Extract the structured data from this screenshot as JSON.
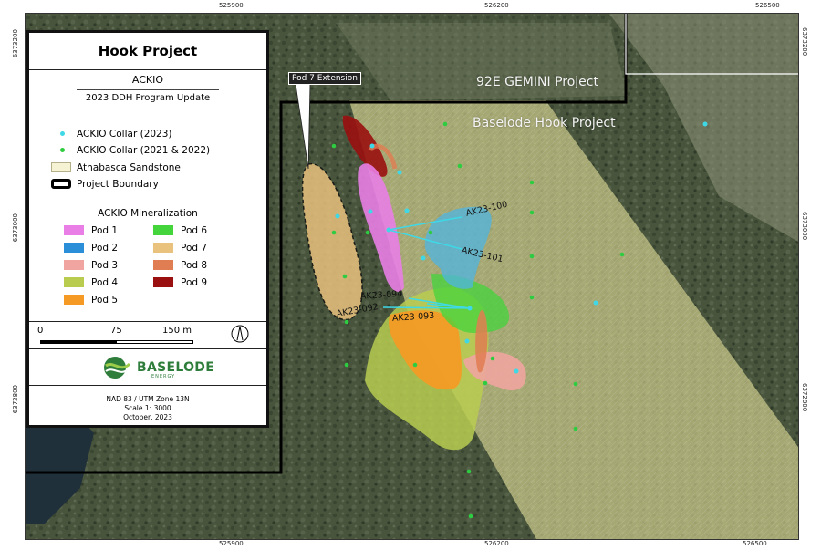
{
  "coords": {
    "top": [
      "525900",
      "526200",
      "526500"
    ],
    "bottom": [
      "525900",
      "526200",
      "526500"
    ],
    "left": [
      "6373200",
      "6373000",
      "6372800"
    ],
    "right": [
      "6373200",
      "6373000",
      "6372800"
    ]
  },
  "legend": {
    "title": "Hook Project",
    "subtitle": "ACKIO",
    "program": "2023 DDH Program Update",
    "symbols": [
      {
        "label": "ACKIO Collar (2023)",
        "color": "#3fd8e6"
      },
      {
        "label": "ACKIO Collar (2021 & 2022)",
        "color": "#2ecc40"
      },
      {
        "label": "Athabasca Sandstone",
        "color": "#f6f2d4"
      },
      {
        "label": "Project Boundary",
        "color": "#000000"
      }
    ],
    "mineralization_title": "ACKIO Mineralization",
    "pods": [
      {
        "label": "Pod 1",
        "color": "#e97ee6"
      },
      {
        "label": "Pod 2",
        "color": "#2a8fd8"
      },
      {
        "label": "Pod 3",
        "color": "#f0a5a0"
      },
      {
        "label": "Pod 4",
        "color": "#b9cc50"
      },
      {
        "label": "Pod 5",
        "color": "#f59a24"
      },
      {
        "label": "Pod 6",
        "color": "#44d43c"
      },
      {
        "label": "Pod 7",
        "color": "#e9c27e"
      },
      {
        "label": "Pod 8",
        "color": "#e07d52"
      },
      {
        "label": "Pod 9",
        "color": "#9a1010"
      }
    ],
    "scale": {
      "zero": "0",
      "mid": "75",
      "end": "150 m"
    },
    "logo": {
      "name": "BASELODE",
      "tag": "ENERGY"
    },
    "footer": [
      "NAD 83 / UTM Zone 13N",
      "Scale 1: 3000",
      "October, 2023"
    ]
  },
  "map": {
    "callout": "Pod 7 Extension",
    "region_labels": [
      "92E GEMINI Project",
      "Baselode Hook Project"
    ],
    "holes": [
      "AK23-100",
      "AK23-101",
      "AK23-094",
      "AK23-092",
      "AK23-093"
    ]
  }
}
